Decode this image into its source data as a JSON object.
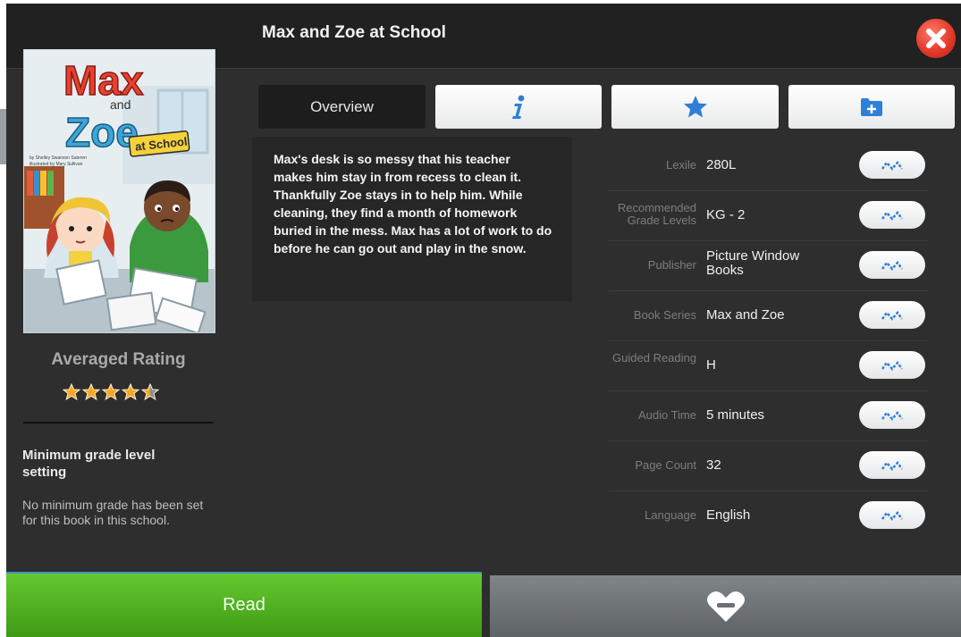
{
  "book": {
    "title": "Max and Zoe at School",
    "cover": {
      "title_line1": "Max",
      "title_line2": "and",
      "title_line3": "Zoe",
      "subtitle": "at School",
      "credit_line1": "by Shelley Swanson Sateren",
      "credit_line2": "illustrated by Mary Sullivan"
    }
  },
  "rating": {
    "label": "Averaged Rating",
    "value": 4.5,
    "max": 5,
    "star_color": "#f5a623"
  },
  "min_grade": {
    "title": "Minimum grade level setting",
    "text": "No minimum grade has been set for this book in this school."
  },
  "tabs": [
    {
      "label": "Overview",
      "active": true
    },
    {
      "icon": "info-icon"
    },
    {
      "icon": "star-icon"
    },
    {
      "icon": "folder-add-icon"
    }
  ],
  "overview": "Max's desk is so messy that his teacher makes him stay in from recess to clean it. Thankfully Zoe stays in to help him. While cleaning, they find a month of homework buried in the mess. Max has a lot of work to do before he can go out and play in the snow.",
  "details": [
    {
      "label": "Lexile",
      "value": "280L"
    },
    {
      "label": "Recommended Grade Levels",
      "value": "KG - 2"
    },
    {
      "label": "Publisher",
      "value": "Picture Window Books"
    },
    {
      "label": "Book Series",
      "value": "Max and Zoe"
    },
    {
      "label": "Guided Reading",
      "value": "H"
    },
    {
      "label": "Audio Time",
      "value": "5 minutes"
    },
    {
      "label": "Page Count",
      "value": "32"
    },
    {
      "label": "Language",
      "value": "English"
    }
  ],
  "footer": {
    "read_label": "Read",
    "favorite_icon": "heart-remove-icon"
  },
  "colors": {
    "accent_blue": "#2f7fd8",
    "read_green": "#4fb020",
    "close_red": "#e33b2b"
  }
}
